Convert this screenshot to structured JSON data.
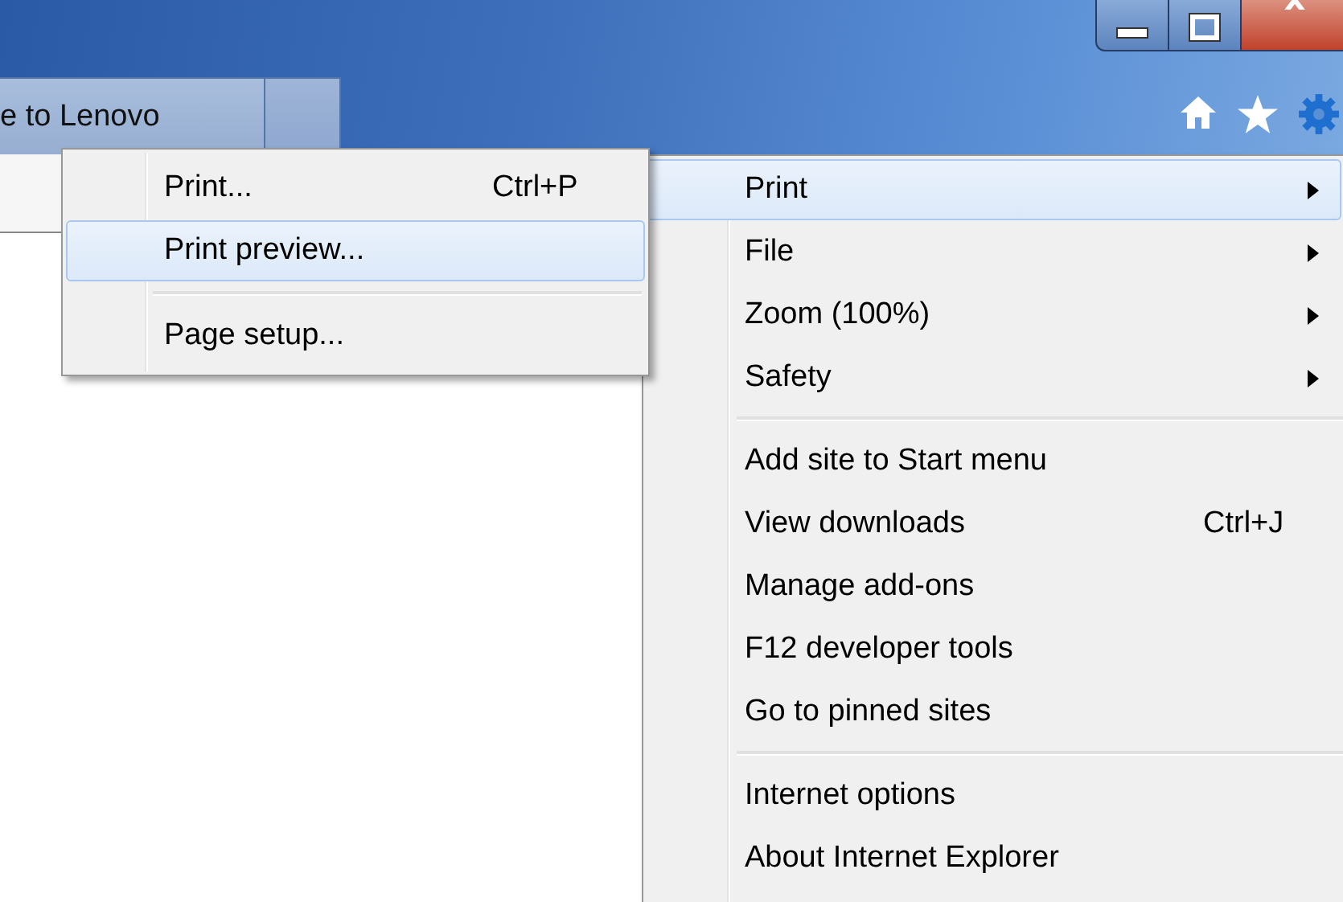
{
  "tabs": [
    {
      "kind": "tab",
      "label": "e to Lenovo"
    },
    {
      "kind": "new-tab"
    }
  ],
  "tools_menu": {
    "items": [
      {
        "kind": "item",
        "label": "Print",
        "submenu": true,
        "selected": true
      },
      {
        "kind": "item",
        "label": "File",
        "submenu": true,
        "selected": false
      },
      {
        "kind": "item",
        "label": "Zoom (100%)",
        "submenu": true,
        "selected": false
      },
      {
        "kind": "item",
        "label": "Safety",
        "submenu": true,
        "selected": false
      },
      {
        "kind": "separator"
      },
      {
        "kind": "item",
        "label": "Add site to Start menu",
        "submenu": false,
        "selected": false
      },
      {
        "kind": "item",
        "label": "View downloads",
        "shortcut": "Ctrl+J",
        "submenu": false,
        "selected": false
      },
      {
        "kind": "item",
        "label": "Manage add-ons",
        "submenu": false,
        "selected": false
      },
      {
        "kind": "item",
        "label": "F12 developer tools",
        "submenu": false,
        "selected": false
      },
      {
        "kind": "item",
        "label": "Go to pinned sites",
        "submenu": false,
        "selected": false
      },
      {
        "kind": "separator"
      },
      {
        "kind": "item",
        "label": "Internet options",
        "submenu": false,
        "selected": false
      },
      {
        "kind": "item",
        "label": "About Internet Explorer",
        "submenu": false,
        "selected": false
      }
    ]
  },
  "print_submenu": {
    "items": [
      {
        "kind": "item",
        "label": "Print...",
        "shortcut": "Ctrl+P",
        "selected": false
      },
      {
        "kind": "item",
        "label": "Print preview...",
        "selected": true
      },
      {
        "kind": "separator"
      },
      {
        "kind": "item",
        "label": "Page setup...",
        "selected": false
      }
    ]
  }
}
